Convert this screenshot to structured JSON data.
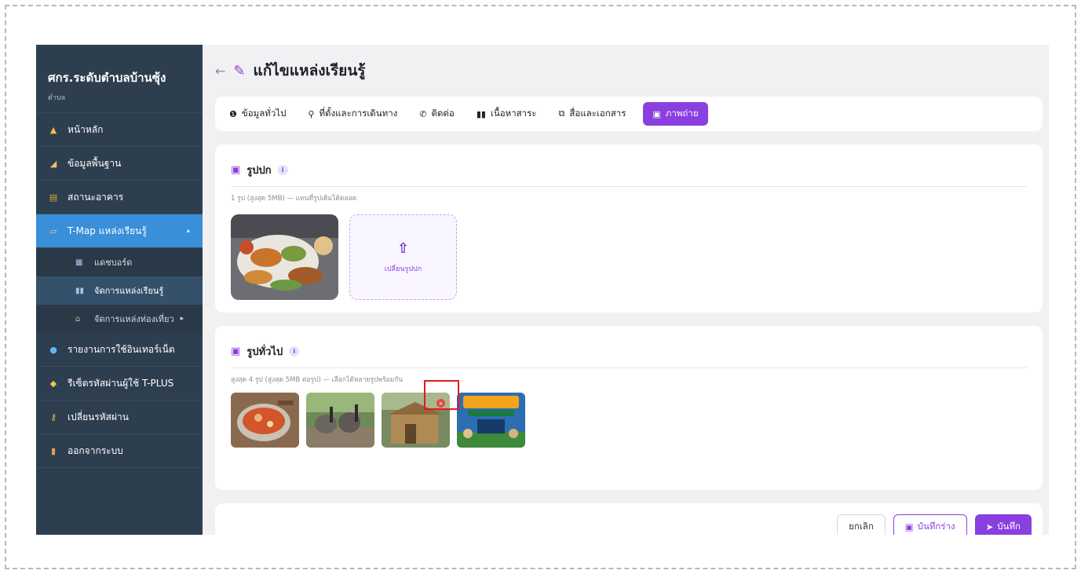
{
  "sidebar": {
    "title": "ศกร.ระดับตำบลบ้านซุ้ง",
    "subtitle": "ตำบล",
    "items": [
      {
        "label": "หน้าหลัก",
        "icon": "home-icon"
      },
      {
        "label": "ข้อมูลพื้นฐาน",
        "icon": "map-icon"
      },
      {
        "label": "สถานะอาคาร",
        "icon": "building-icon"
      },
      {
        "label": "T-Map แหล่งเรียนรู้",
        "icon": "map-book-icon"
      },
      {
        "label": "รายงานการใช้อินเทอร์เน็ต",
        "icon": "globe-icon"
      },
      {
        "label": "รีเซ็ตรหัสผ่านผู้ใช้ T-PLUS",
        "icon": "user-key-icon"
      },
      {
        "label": "เปลี่ยนรหัสผ่าน",
        "icon": "key-icon"
      },
      {
        "label": "ออกจากระบบ",
        "icon": "logout-icon"
      }
    ],
    "sub_items": [
      {
        "label": "แดชบอร์ด",
        "icon": "dashboard-icon"
      },
      {
        "label": "จัดการแหล่งเรียนรู้",
        "icon": "book-icon"
      },
      {
        "label": "จัดการแหล่งท่องเที่ยว",
        "icon": "landmark-icon"
      }
    ]
  },
  "header": {
    "back": "←",
    "title": "แก้ไขแหล่งเรียนรู้"
  },
  "tabs": [
    {
      "label": "ข้อมูลทั่วไป",
      "icon": "info-icon",
      "glyph": "❶"
    },
    {
      "label": "ที่ตั้งและการเดินทาง",
      "icon": "location-pin-icon",
      "glyph": "⚲"
    },
    {
      "label": "ติดต่อ",
      "icon": "phone-icon",
      "glyph": "✆"
    },
    {
      "label": "เนื้อหาสาระ",
      "icon": "book-open-icon",
      "glyph": "▮▮"
    },
    {
      "label": "สื่อและเอกสาร",
      "icon": "media-icon",
      "glyph": "⧉"
    },
    {
      "label": "ภาพถ่าย",
      "icon": "images-icon",
      "glyph": "▣",
      "active": true
    }
  ],
  "cover": {
    "title": "รูปปก",
    "hint": "1 รูป (สูงสุด 5MB) — แทนที่รูปเดิมได้ตลอด",
    "change_label": "เปลี่ยนรูปปก"
  },
  "gallery": {
    "title": "รูปทั่วไป",
    "hint": "สูงสุด 4 รูป (สูงสุด 5MB ต่อรูป) — เลือกได้หลายรูปพร้อมกัน",
    "delete_glyph": "×",
    "photos": [
      "thai-soup-photo",
      "elephant-camp-photo",
      "bamboo-hut-photo",
      "learning-center-poster"
    ]
  },
  "footer": {
    "cancel": "ยกเลิก",
    "draft": "บันทึกร่าง",
    "save": "บันทึก"
  },
  "colors": {
    "accent": "#8a3fe0",
    "sidebar": "#2d3e4f",
    "active_nav": "#3a8fd9",
    "delete": "#e24a4a"
  }
}
